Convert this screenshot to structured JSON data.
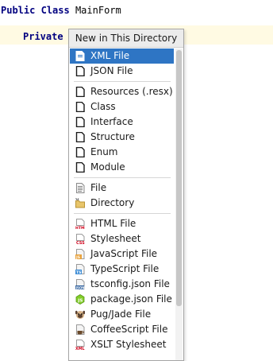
{
  "editor": {
    "line1": {
      "kw1": "Public",
      "kw2": "Class",
      "name": "MainForm"
    },
    "line2": {
      "kw1": "Private"
    }
  },
  "popup": {
    "title": "New in This Directory",
    "items": [
      {
        "label": "XML File",
        "icon": "xml-file-icon",
        "selected": true
      },
      {
        "label": "JSON File",
        "icon": "json-file-icon"
      },
      {
        "label": "Resources (.resx)",
        "icon": "resources-file-icon"
      },
      {
        "label": "Class",
        "icon": "class-file-icon"
      },
      {
        "label": "Interface",
        "icon": "interface-file-icon"
      },
      {
        "label": "Structure",
        "icon": "structure-file-icon"
      },
      {
        "label": "Enum",
        "icon": "enum-file-icon"
      },
      {
        "label": "Module",
        "icon": "module-file-icon"
      },
      {
        "label": "File",
        "icon": "text-file-icon"
      },
      {
        "label": "Directory",
        "icon": "folder-icon"
      },
      {
        "label": "HTML File",
        "icon": "html-file-icon"
      },
      {
        "label": "Stylesheet",
        "icon": "css-file-icon"
      },
      {
        "label": "JavaScript File",
        "icon": "javascript-file-icon"
      },
      {
        "label": "TypeScript File",
        "icon": "typescript-file-icon"
      },
      {
        "label": "tsconfig.json File",
        "icon": "tsconfig-json-icon"
      },
      {
        "label": "package.json File",
        "icon": "nodejs-package-icon"
      },
      {
        "label": "Pug/Jade File",
        "icon": "pug-file-icon"
      },
      {
        "label": "CoffeeScript File",
        "icon": "coffeescript-file-icon"
      },
      {
        "label": "XSLT Stylesheet",
        "icon": "xslt-file-icon"
      }
    ]
  },
  "colors": {
    "selection": "#2e75c4",
    "keyword": "#000080",
    "current_line": "#fffae3"
  }
}
